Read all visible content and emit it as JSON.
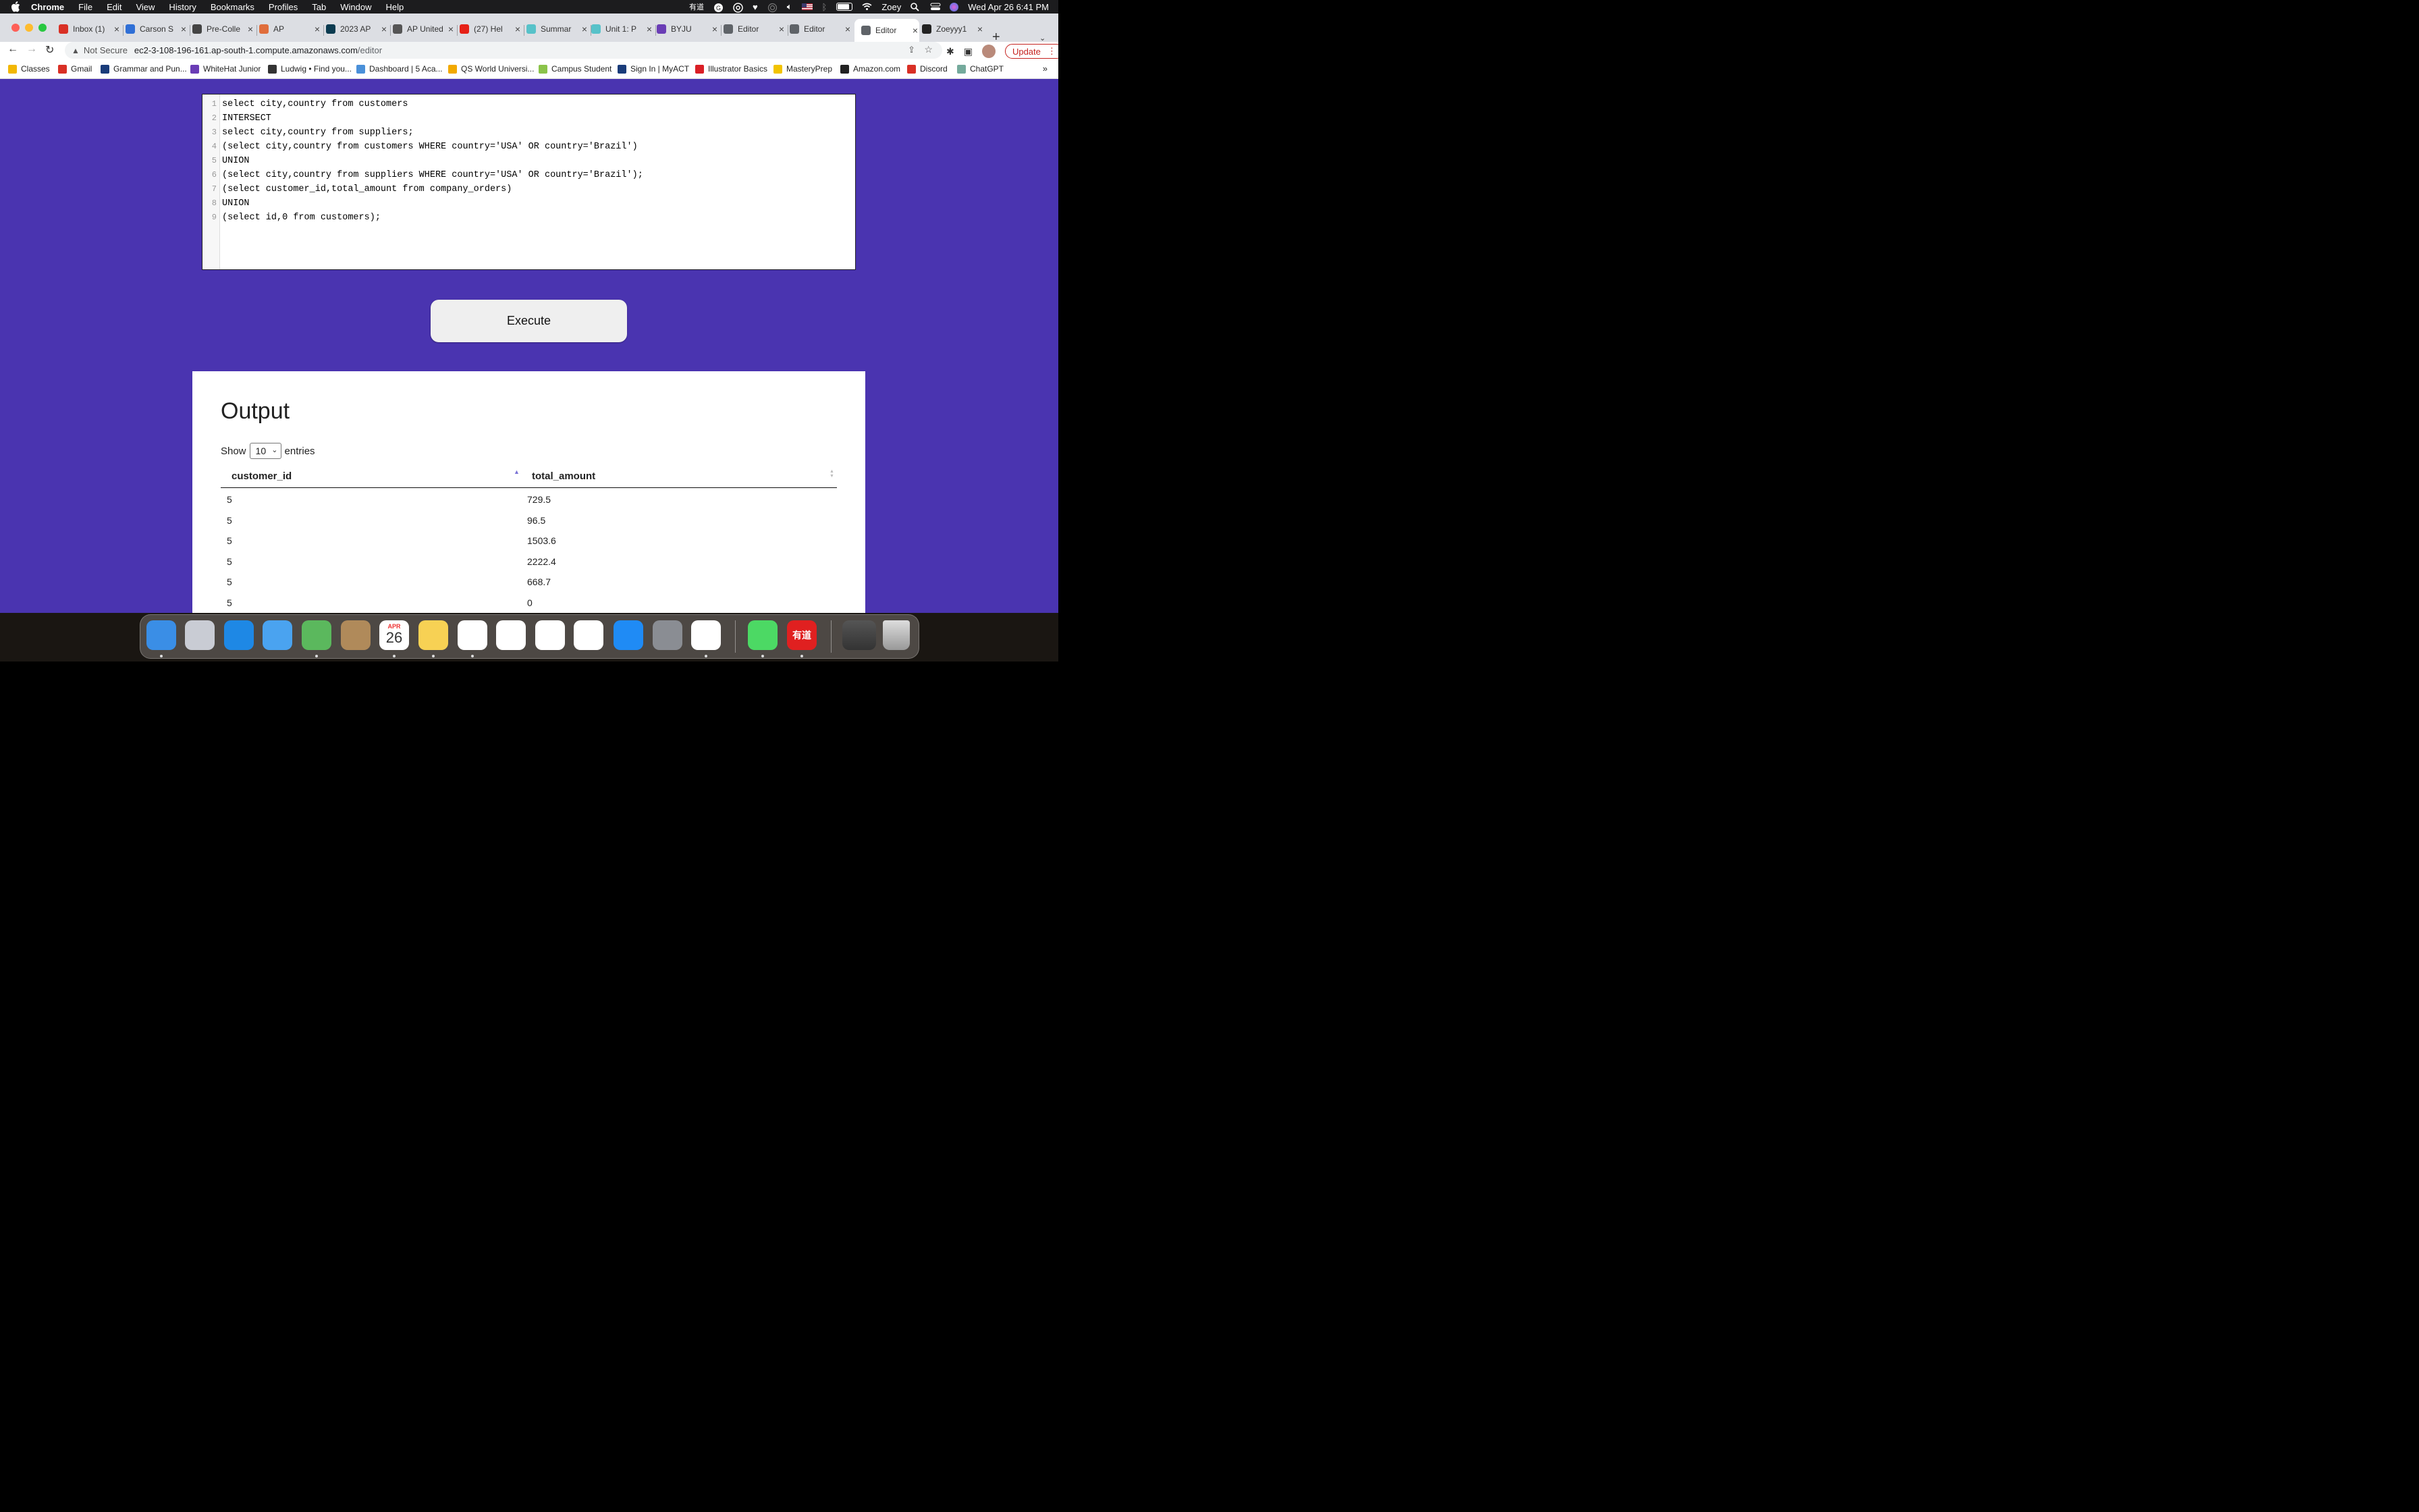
{
  "menubar": {
    "items": [
      "Chrome",
      "File",
      "Edit",
      "View",
      "History",
      "Bookmarks",
      "Profiles",
      "Tab",
      "Window",
      "Help"
    ],
    "user": "Zoey",
    "clock": "Wed Apr 26  6:41 PM",
    "status_cn": "有道"
  },
  "tabs": [
    {
      "title": "Inbox (1)",
      "color": "#d93025"
    },
    {
      "title": "Carson S",
      "color": "#2f6fd6"
    },
    {
      "title": "Pre-Colle",
      "color": "#444444"
    },
    {
      "title": "AP",
      "color": "#e06d3b"
    },
    {
      "title": "2023 AP",
      "color": "#0b3b50"
    },
    {
      "title": "AP United",
      "color": "#555555"
    },
    {
      "title": "(27) Hel",
      "color": "#e62117"
    },
    {
      "title": "Summar",
      "color": "#57c2c9"
    },
    {
      "title": "Unit 1: P",
      "color": "#57c2c9"
    },
    {
      "title": "BYJU",
      "color": "#6a3db5"
    },
    {
      "title": "Editor",
      "color": "#5f6368"
    },
    {
      "title": "Editor",
      "color": "#5f6368"
    },
    {
      "title": "Editor",
      "color": "#5f6368"
    },
    {
      "title": "Zoeyyy1",
      "color": "#222222"
    }
  ],
  "toolbar": {
    "not_secure": "Not Secure",
    "url_host": "ec2-3-108-196-161.ap-south-1.compute.amazonaws.com",
    "url_path": "/editor",
    "update_label": "Update"
  },
  "bookmarks": [
    {
      "label": "Classes",
      "color": "#f2b705"
    },
    {
      "label": "Gmail",
      "color": "#d93025"
    },
    {
      "label": "Grammar and Pun...",
      "color": "#1a3c7a"
    },
    {
      "label": "WhiteHat Junior",
      "color": "#6a3db5"
    },
    {
      "label": "Ludwig • Find you...",
      "color": "#333333"
    },
    {
      "label": "Dashboard | 5 Aca...",
      "color": "#4a90d9"
    },
    {
      "label": "QS World Universi...",
      "color": "#f2a900"
    },
    {
      "label": "Campus Student",
      "color": "#8bc34a"
    },
    {
      "label": "Sign In | MyACT",
      "color": "#1a3c7a"
    },
    {
      "label": "Illustrator Basics",
      "color": "#da1f26"
    },
    {
      "label": "MasteryPrep",
      "color": "#f2c300"
    },
    {
      "label": "Amazon.com",
      "color": "#222222"
    },
    {
      "label": "Discord",
      "color": "#d93025"
    },
    {
      "label": "ChatGPT",
      "color": "#74aa9c"
    }
  ],
  "editor": {
    "lines": [
      "select city,country from customers",
      "INTERSECT",
      "select city,country from suppliers;",
      "(select city,country from customers WHERE country='USA' OR country='Brazil')",
      "UNION",
      "(select city,country from suppliers WHERE country='USA' OR country='Brazil');",
      "(select customer_id,total_amount from company_orders)",
      "UNION",
      "(select id,0 from customers);"
    ]
  },
  "execute_label": "Execute",
  "output": {
    "title": "Output",
    "show_label": "Show",
    "entries_value": "10",
    "entries_label": "entries",
    "columns": [
      "customer_id",
      "total_amount"
    ],
    "rows": [
      [
        "5",
        "729.5"
      ],
      [
        "5",
        "96.5"
      ],
      [
        "5",
        "1503.6"
      ],
      [
        "5",
        "2222.4"
      ],
      [
        "5",
        "668.7"
      ],
      [
        "5",
        "0"
      ]
    ]
  },
  "dock": {
    "apps": [
      {
        "name": "finder",
        "color": "#3a8ee6"
      },
      {
        "name": "launchpad",
        "color": "#c9ccd4"
      },
      {
        "name": "safari",
        "color": "#1e88e5"
      },
      {
        "name": "mail",
        "color": "#4aa3f0"
      },
      {
        "name": "maps",
        "color": "#5bb85d"
      },
      {
        "name": "contacts",
        "color": "#b08a5a"
      },
      {
        "name": "calendar",
        "color": "#ffffff"
      },
      {
        "name": "notes",
        "color": "#f7d154"
      },
      {
        "name": "news",
        "color": "#ffffff"
      },
      {
        "name": "numbers",
        "color": "#ffffff"
      },
      {
        "name": "keynote",
        "color": "#ffffff"
      },
      {
        "name": "pages",
        "color": "#ffffff"
      },
      {
        "name": "app-store",
        "color": "#1f8bf5"
      },
      {
        "name": "system-settings",
        "color": "#8a8d93"
      },
      {
        "name": "chrome",
        "color": "#ffffff"
      },
      {
        "name": "messages",
        "color": "#4cd964"
      },
      {
        "name": "youdao",
        "color": "#e02020"
      }
    ],
    "calendar_month": "APR",
    "calendar_day": "26"
  }
}
